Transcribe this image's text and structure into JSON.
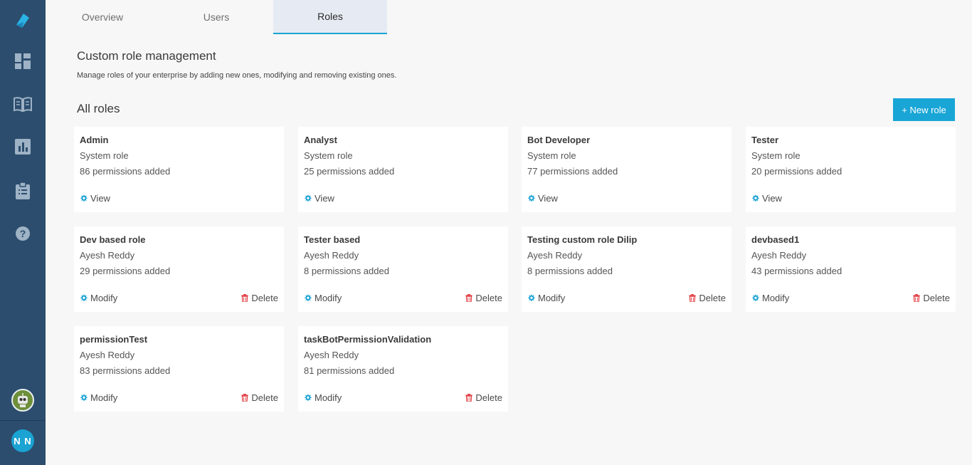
{
  "sidebar": {
    "items": [
      {
        "icon": "logo-icon"
      },
      {
        "icon": "dashboard-icon"
      },
      {
        "icon": "book-icon"
      },
      {
        "icon": "bar-chart-icon"
      },
      {
        "icon": "clipboard-icon"
      },
      {
        "icon": "help-icon"
      }
    ],
    "bot_avatar": {
      "icon": "bot-avatar-icon"
    },
    "user_initials": "N N"
  },
  "tabs": [
    {
      "label": "Overview",
      "active": false
    },
    {
      "label": "Users",
      "active": false
    },
    {
      "label": "Roles",
      "active": true
    }
  ],
  "header": {
    "title": "Custom role management",
    "subtitle": "Manage roles of your enterprise by adding new ones, modifying and removing existing ones."
  },
  "roles_section": {
    "heading": "All roles",
    "new_role_label": "+ New role"
  },
  "actions": {
    "view": "View",
    "modify": "Modify",
    "delete": "Delete"
  },
  "roles": [
    {
      "name": "Admin",
      "owner": "System role",
      "permissions": "86 permissions added"
    },
    {
      "name": "Analyst",
      "owner": "System role",
      "permissions": "25 permissions added"
    },
    {
      "name": "Bot Developer",
      "owner": "System role",
      "permissions": "77 permissions added"
    },
    {
      "name": "Tester",
      "owner": "System role",
      "permissions": "20 permissions added"
    },
    {
      "name": "Dev based role",
      "owner": "Ayesh Reddy",
      "permissions": "29 permissions added"
    },
    {
      "name": "Tester based",
      "owner": "Ayesh Reddy",
      "permissions": "8 permissions added"
    },
    {
      "name": "Testing custom role Dilip",
      "owner": "Ayesh Reddy",
      "permissions": "8 permissions added"
    },
    {
      "name": "devbased1",
      "owner": "Ayesh Reddy",
      "permissions": "43 permissions added"
    },
    {
      "name": "permissionTest",
      "owner": "Ayesh Reddy",
      "permissions": "83 permissions added"
    },
    {
      "name": "taskBotPermissionValidation",
      "owner": "Ayesh Reddy",
      "permissions": "81 permissions added"
    }
  ],
  "colors": {
    "sidebar": "#2c4d6e",
    "accent": "#1aa3d3",
    "delete": "#e0393e"
  }
}
